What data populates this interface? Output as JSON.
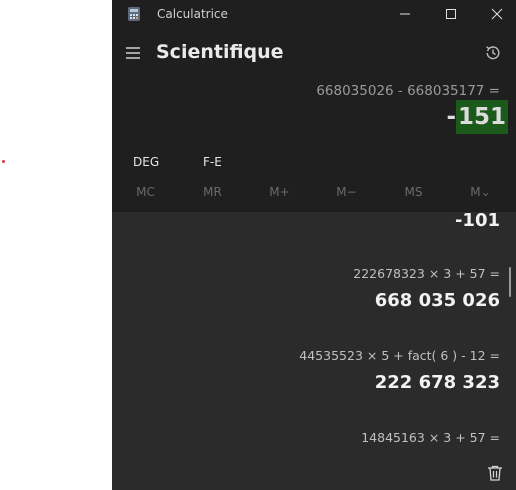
{
  "window": {
    "title": "Calculatrice",
    "mode": "Scientifique"
  },
  "display": {
    "expression": "668035026 - 668035177 =",
    "result_prefix": "-",
    "result_selected": "151"
  },
  "settings": {
    "angle_mode": "DEG",
    "fe_label": "F-E"
  },
  "memory": {
    "buttons": [
      "MC",
      "MR",
      "M+",
      "M−",
      "MS",
      "M⌄"
    ]
  },
  "history": {
    "items": [
      {
        "expression": "",
        "result": "-101"
      },
      {
        "expression": "222678323   ×   3   +   57 =",
        "result": "668 035 026"
      },
      {
        "expression": "44535523   ×   5   +   fact( 6 )   -   12 =",
        "result": "222 678 323"
      },
      {
        "expression": "14845163   ×   3   +   57 =",
        "result": ""
      }
    ]
  },
  "icons": {
    "app": "calculator-icon",
    "menu": "hamburger-icon",
    "history": "history-icon",
    "delete": "trash-icon"
  },
  "colors": {
    "window_bg": "#1f1f1f",
    "history_bg": "#2b2b2b",
    "selection": "#1c5a1c"
  }
}
